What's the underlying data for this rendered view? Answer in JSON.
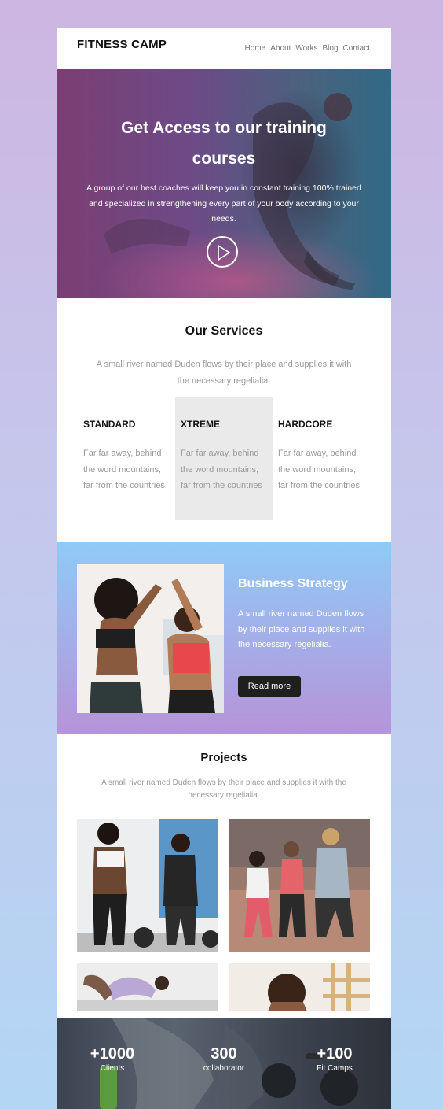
{
  "header": {
    "logo": "FITNESS CAMP",
    "nav": [
      "Home",
      "About",
      "Works",
      "Blog",
      "Contact"
    ]
  },
  "hero": {
    "title": "Get Access to our training courses",
    "text": "A group of our best coaches will keep you in constant training 100% trained and specialized in strengthening every part of your body according to your needs.",
    "play_icon": "play-icon"
  },
  "services": {
    "title": "Our Services",
    "subtitle": "A small river named Duden flows by their place and supplies it with the necessary regelialia.",
    "items": [
      {
        "name": "STANDARD",
        "text": "Far far away, behind the word mountains, far from the countries"
      },
      {
        "name": "XTREME",
        "text": "Far far away, behind the word mountains, far from the countries"
      },
      {
        "name": "HARDCORE",
        "text": "Far far away, behind the word mountains, far from the countries"
      }
    ]
  },
  "business": {
    "title": "Business Strategy",
    "text": "A small river named Duden flows by their place and supplies it with the necessary regelialia.",
    "button": "Read more"
  },
  "projects": {
    "title": "Projects",
    "subtitle": "A small river named Duden flows by their place and supplies it with the necessary regelialia."
  },
  "stats": [
    {
      "value": "+1000",
      "label": "Clients"
    },
    {
      "value": "300",
      "label": "collaborator"
    },
    {
      "value": "+100",
      "label": "Fit Camps"
    }
  ],
  "colors": {
    "dark": "#111111",
    "muted": "#9a9a9a",
    "button": "#1f1f1f"
  }
}
